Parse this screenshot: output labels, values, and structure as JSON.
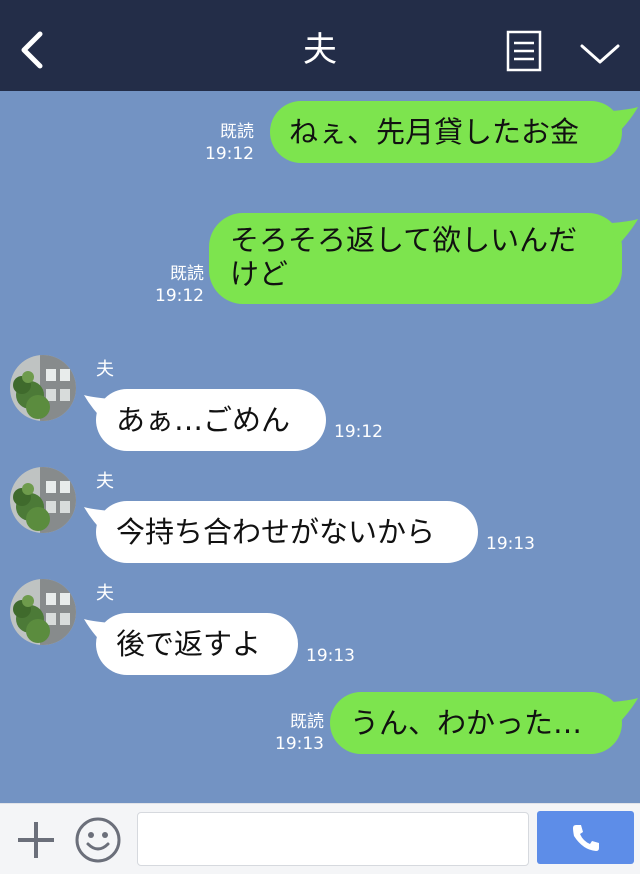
{
  "header": {
    "title": "夫"
  },
  "messages": [
    {
      "dir": "out",
      "lines": [
        "ねぇ、先月貸したお金"
      ],
      "read": "既読",
      "time": "19:12"
    },
    {
      "dir": "out",
      "lines": [
        "そろそろ返して欲しいんだ",
        "けど"
      ],
      "read": "既読",
      "time": "19:12"
    },
    {
      "dir": "in",
      "sender": "夫",
      "lines": [
        "あぁ…ごめん"
      ],
      "time": "19:12"
    },
    {
      "dir": "in",
      "sender": "夫",
      "lines": [
        "今持ち合わせがないから"
      ],
      "time": "19:13"
    },
    {
      "dir": "in",
      "sender": "夫",
      "lines": [
        "後で返すよ"
      ],
      "time": "19:13"
    },
    {
      "dir": "out",
      "lines": [
        "うん、わかった…"
      ],
      "read": "既読",
      "time": "19:13"
    }
  ],
  "input": {
    "value": "",
    "placeholder": ""
  },
  "colors": {
    "header_bg": "#232d48",
    "chat_bg": "#7393c3",
    "out_bubble": "#7de44e",
    "in_bubble": "#ffffff",
    "call_button": "#5d8de8"
  },
  "icons": {
    "back": "chevron-left-icon",
    "note": "note-icon",
    "menu": "chevron-down-icon",
    "plus": "plus-icon",
    "sticker": "smile-icon",
    "call": "phone-icon"
  }
}
